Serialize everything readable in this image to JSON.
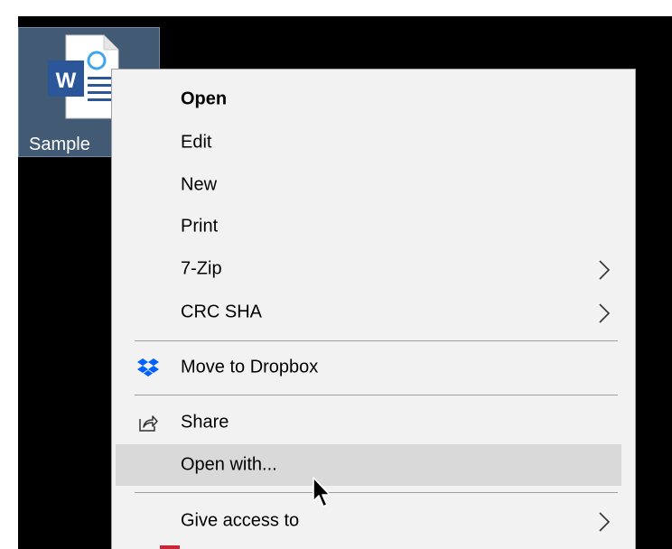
{
  "desktop": {
    "file": {
      "name": "Sample",
      "type_icon": "word-document-icon",
      "badge": "W"
    }
  },
  "context_menu": {
    "items": [
      {
        "label": "Open",
        "bold": true
      },
      {
        "label": "Edit"
      },
      {
        "label": "New"
      },
      {
        "label": "Print"
      },
      {
        "label": "7-Zip",
        "submenu": true
      },
      {
        "label": "CRC SHA",
        "submenu": true
      },
      {
        "label": "Move to Dropbox",
        "icon": "dropbox-icon"
      },
      {
        "label": "Share",
        "icon": "share-icon"
      },
      {
        "label": "Open with...",
        "hovered": true
      },
      {
        "label": "Give access to",
        "submenu": true
      }
    ],
    "colors": {
      "background": "#f2f2f2",
      "hover": "#d9d9d9",
      "separator": "#a0a0a0",
      "dropbox": "#0061fe"
    }
  }
}
